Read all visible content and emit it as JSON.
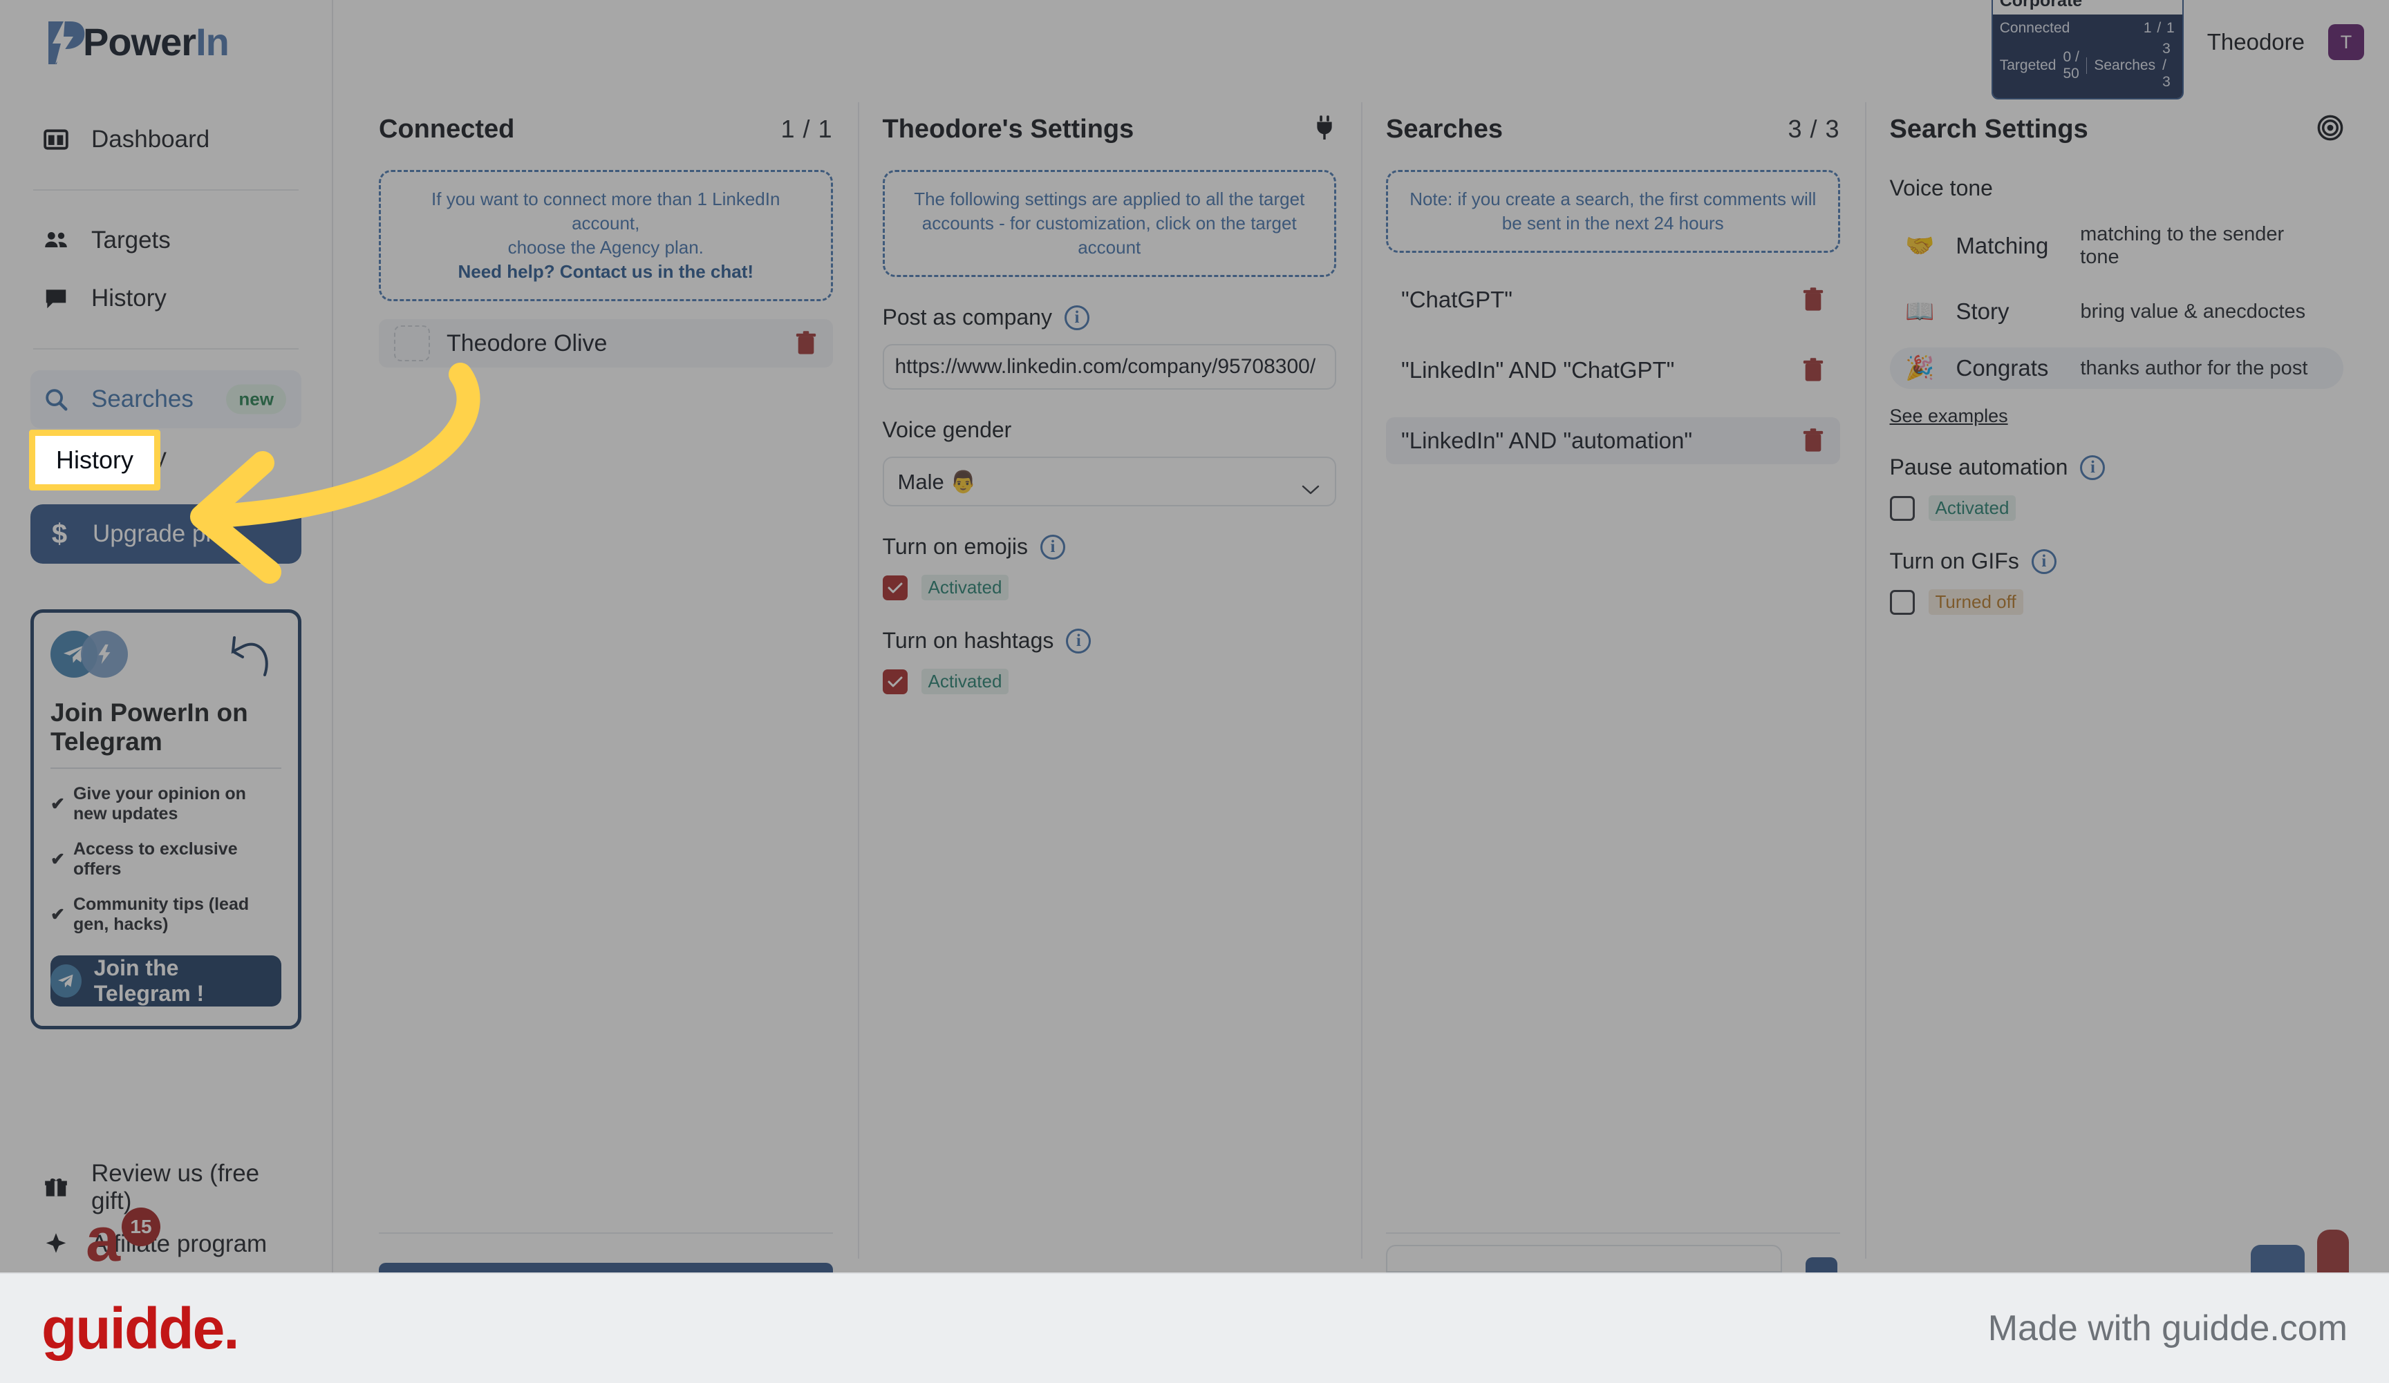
{
  "brand": {
    "name_power": "Power",
    "name_in": "In",
    "accent": "#4a74ab"
  },
  "sidebar": {
    "items": [
      {
        "label": "Dashboard",
        "icon": "dashboard-icon"
      },
      {
        "label": "Targets",
        "icon": "people-icon"
      },
      {
        "label": "History",
        "icon": "chat-icon"
      }
    ],
    "group": [
      {
        "label": "Searches",
        "icon": "search-icon",
        "badge": "new"
      },
      {
        "label": "History",
        "icon": "chat-icon"
      }
    ],
    "upgrade": {
      "label": "Upgrade plan",
      "icon": "dollar-icon"
    },
    "telegram": {
      "title": "Join PowerIn on Telegram",
      "bullets": [
        "Give your opinion on new updates",
        "Access to exclusive offers",
        "Community tips (lead gen, hacks)"
      ],
      "button": "Join the Telegram !"
    },
    "bottom": [
      {
        "label": "Review us (free gift)",
        "icon": "gift-icon"
      },
      {
        "label": "Affiliate program",
        "icon": "star-icon",
        "badge": "15"
      }
    ]
  },
  "topbar": {
    "plan": {
      "title": "Corporate",
      "connected_label": "Connected",
      "connected_value": "1 / 1",
      "targeted_label": "Targeted",
      "targeted_value": "0 / 50",
      "searches_label": "Searches",
      "searches_value": "3 / 3"
    },
    "user_name": "Theodore",
    "avatar_initial": "T"
  },
  "columns": {
    "connected": {
      "title": "Connected",
      "count": "1 / 1",
      "notice_line1": "If you want to connect more than 1 LinkedIn account,",
      "notice_line2": "choose the Agency plan.",
      "notice_strong": "Need help? Contact us in the chat!",
      "accounts": [
        {
          "name": "Theodore Olive"
        }
      ]
    },
    "settings": {
      "title": "Theodore's Settings",
      "icon": "plug-icon",
      "notice": "The following settings are applied to all the target accounts - for customization, click on the target account",
      "post_as_company_label": "Post as company",
      "post_as_company_value": "https://www.linkedin.com/company/95708300/",
      "voice_gender_label": "Voice gender",
      "voice_gender_value": "Male 👨",
      "emojis_label": "Turn on emojis",
      "emojis_state": "Activated",
      "hashtags_label": "Turn on hashtags",
      "hashtags_state": "Activated"
    },
    "searches": {
      "title": "Searches",
      "count": "3 / 3",
      "notice": "Note: if you create a search, the first comments will be sent in the next 24 hours",
      "items": [
        {
          "query": "\"ChatGPT\"",
          "selected": false
        },
        {
          "query": "\"LinkedIn\" AND \"ChatGPT\"",
          "selected": false
        },
        {
          "query": "\"LinkedIn\" AND \"automation\"",
          "selected": true
        }
      ]
    },
    "search_settings": {
      "title": "Search Settings",
      "icon": "target-icon",
      "voice_tone_label": "Voice tone",
      "tones": [
        {
          "emoji": "🤝",
          "name": "Matching",
          "desc": "matching to the sender tone",
          "selected": false
        },
        {
          "emoji": "📖",
          "name": "Story",
          "desc": "bring value & anecdoctes",
          "selected": false
        },
        {
          "emoji": "🎉",
          "name": "Congrats",
          "desc": "thanks author for the post",
          "selected": true
        }
      ],
      "see_examples": "See examples",
      "pause_label": "Pause automation",
      "pause_state": "Activated",
      "gifs_label": "Turn on GIFs",
      "gifs_state": "Turned off"
    }
  },
  "callout": {
    "highlight_label": "History",
    "highlight_color": "#ffd24a"
  },
  "footer": {
    "logo": "guidde.",
    "made_with": "Made with guidde.com"
  }
}
